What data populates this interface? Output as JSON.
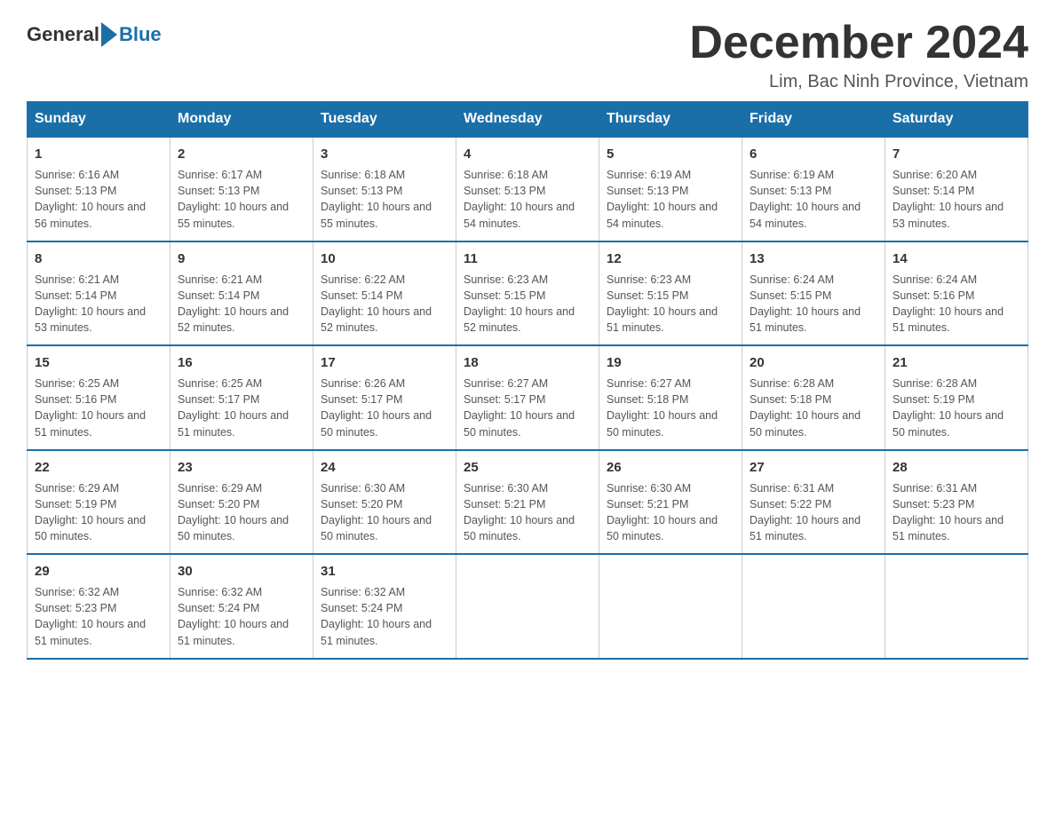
{
  "header": {
    "logo_general": "General",
    "logo_blue": "Blue",
    "month_title": "December 2024",
    "location": "Lim, Bac Ninh Province, Vietnam"
  },
  "days_of_week": [
    "Sunday",
    "Monday",
    "Tuesday",
    "Wednesday",
    "Thursday",
    "Friday",
    "Saturday"
  ],
  "weeks": [
    [
      {
        "day": "1",
        "sunrise": "6:16 AM",
        "sunset": "5:13 PM",
        "daylight": "10 hours and 56 minutes."
      },
      {
        "day": "2",
        "sunrise": "6:17 AM",
        "sunset": "5:13 PM",
        "daylight": "10 hours and 55 minutes."
      },
      {
        "day": "3",
        "sunrise": "6:18 AM",
        "sunset": "5:13 PM",
        "daylight": "10 hours and 55 minutes."
      },
      {
        "day": "4",
        "sunrise": "6:18 AM",
        "sunset": "5:13 PM",
        "daylight": "10 hours and 54 minutes."
      },
      {
        "day": "5",
        "sunrise": "6:19 AM",
        "sunset": "5:13 PM",
        "daylight": "10 hours and 54 minutes."
      },
      {
        "day": "6",
        "sunrise": "6:19 AM",
        "sunset": "5:13 PM",
        "daylight": "10 hours and 54 minutes."
      },
      {
        "day": "7",
        "sunrise": "6:20 AM",
        "sunset": "5:14 PM",
        "daylight": "10 hours and 53 minutes."
      }
    ],
    [
      {
        "day": "8",
        "sunrise": "6:21 AM",
        "sunset": "5:14 PM",
        "daylight": "10 hours and 53 minutes."
      },
      {
        "day": "9",
        "sunrise": "6:21 AM",
        "sunset": "5:14 PM",
        "daylight": "10 hours and 52 minutes."
      },
      {
        "day": "10",
        "sunrise": "6:22 AM",
        "sunset": "5:14 PM",
        "daylight": "10 hours and 52 minutes."
      },
      {
        "day": "11",
        "sunrise": "6:23 AM",
        "sunset": "5:15 PM",
        "daylight": "10 hours and 52 minutes."
      },
      {
        "day": "12",
        "sunrise": "6:23 AM",
        "sunset": "5:15 PM",
        "daylight": "10 hours and 51 minutes."
      },
      {
        "day": "13",
        "sunrise": "6:24 AM",
        "sunset": "5:15 PM",
        "daylight": "10 hours and 51 minutes."
      },
      {
        "day": "14",
        "sunrise": "6:24 AM",
        "sunset": "5:16 PM",
        "daylight": "10 hours and 51 minutes."
      }
    ],
    [
      {
        "day": "15",
        "sunrise": "6:25 AM",
        "sunset": "5:16 PM",
        "daylight": "10 hours and 51 minutes."
      },
      {
        "day": "16",
        "sunrise": "6:25 AM",
        "sunset": "5:17 PM",
        "daylight": "10 hours and 51 minutes."
      },
      {
        "day": "17",
        "sunrise": "6:26 AM",
        "sunset": "5:17 PM",
        "daylight": "10 hours and 50 minutes."
      },
      {
        "day": "18",
        "sunrise": "6:27 AM",
        "sunset": "5:17 PM",
        "daylight": "10 hours and 50 minutes."
      },
      {
        "day": "19",
        "sunrise": "6:27 AM",
        "sunset": "5:18 PM",
        "daylight": "10 hours and 50 minutes."
      },
      {
        "day": "20",
        "sunrise": "6:28 AM",
        "sunset": "5:18 PM",
        "daylight": "10 hours and 50 minutes."
      },
      {
        "day": "21",
        "sunrise": "6:28 AM",
        "sunset": "5:19 PM",
        "daylight": "10 hours and 50 minutes."
      }
    ],
    [
      {
        "day": "22",
        "sunrise": "6:29 AM",
        "sunset": "5:19 PM",
        "daylight": "10 hours and 50 minutes."
      },
      {
        "day": "23",
        "sunrise": "6:29 AM",
        "sunset": "5:20 PM",
        "daylight": "10 hours and 50 minutes."
      },
      {
        "day": "24",
        "sunrise": "6:30 AM",
        "sunset": "5:20 PM",
        "daylight": "10 hours and 50 minutes."
      },
      {
        "day": "25",
        "sunrise": "6:30 AM",
        "sunset": "5:21 PM",
        "daylight": "10 hours and 50 minutes."
      },
      {
        "day": "26",
        "sunrise": "6:30 AM",
        "sunset": "5:21 PM",
        "daylight": "10 hours and 50 minutes."
      },
      {
        "day": "27",
        "sunrise": "6:31 AM",
        "sunset": "5:22 PM",
        "daylight": "10 hours and 51 minutes."
      },
      {
        "day": "28",
        "sunrise": "6:31 AM",
        "sunset": "5:23 PM",
        "daylight": "10 hours and 51 minutes."
      }
    ],
    [
      {
        "day": "29",
        "sunrise": "6:32 AM",
        "sunset": "5:23 PM",
        "daylight": "10 hours and 51 minutes."
      },
      {
        "day": "30",
        "sunrise": "6:32 AM",
        "sunset": "5:24 PM",
        "daylight": "10 hours and 51 minutes."
      },
      {
        "day": "31",
        "sunrise": "6:32 AM",
        "sunset": "5:24 PM",
        "daylight": "10 hours and 51 minutes."
      },
      null,
      null,
      null,
      null
    ]
  ],
  "labels": {
    "sunrise": "Sunrise:",
    "sunset": "Sunset:",
    "daylight": "Daylight:"
  }
}
